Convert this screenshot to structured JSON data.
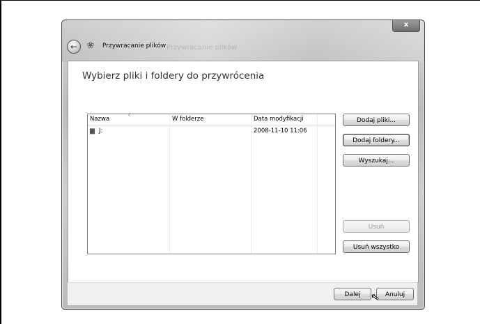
{
  "window": {
    "title": "Przywracanie plików",
    "title_ghost": "Przywracanie plików",
    "close_glyph": "x"
  },
  "page": {
    "heading": "Wybierz pliki i foldery do przywrócenia"
  },
  "list": {
    "columns": [
      "Nazwa",
      "W folderze",
      "Data modyfikacji"
    ],
    "rows": [
      {
        "name": "J:",
        "folder": "",
        "modified": "2008-11-10 11:06"
      }
    ]
  },
  "buttons": {
    "add_files": "Dodaj pliki...",
    "add_folders": "Dodaj foldery...",
    "search": "Wyszukaj...",
    "remove": "Usuń",
    "remove_all": "Usuń wszystko",
    "next": "Dalej",
    "cancel": "Anuluj"
  },
  "icons": {
    "back": "back-arrow-icon",
    "app": "restore-files-icon",
    "drive": "drive-icon",
    "cursor": "mouse-pointer-icon"
  }
}
